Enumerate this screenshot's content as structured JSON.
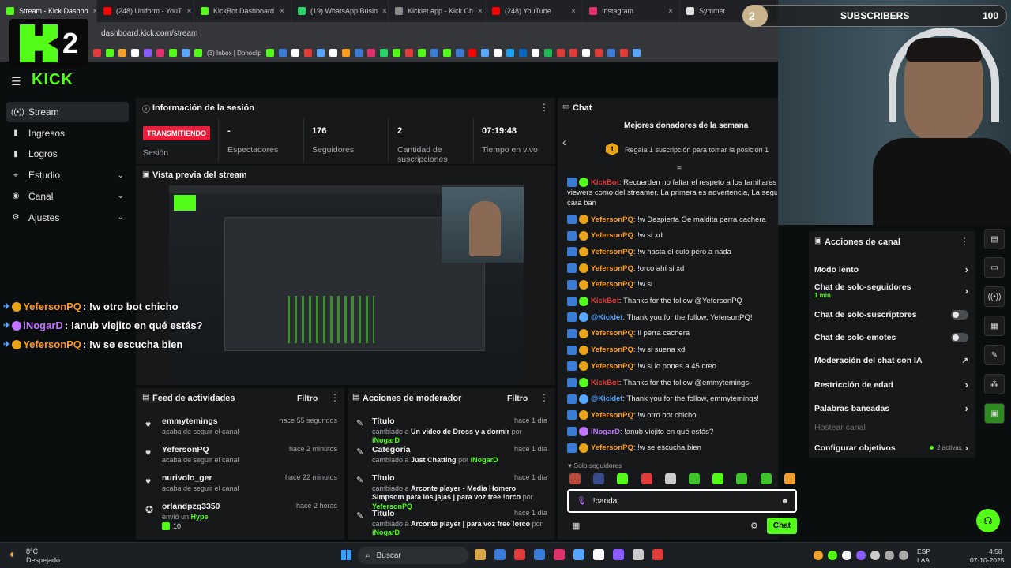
{
  "browser": {
    "tabs": [
      {
        "label": "Stream - Kick Dashbo",
        "active": true,
        "color": "#53fc18"
      },
      {
        "label": "(248) Uniform - YouT",
        "color": "#ff0000"
      },
      {
        "label": "KickBot Dashboard",
        "color": "#53fc18"
      },
      {
        "label": "(19) WhatsApp Busin",
        "color": "#25d366"
      },
      {
        "label": "Kicklet.app - Kick Ch",
        "color": "#888888"
      },
      {
        "label": "(248) YouTube",
        "color": "#ff0000"
      },
      {
        "label": "Instagram",
        "color": "#e1306c"
      },
      {
        "label": "Symmet",
        "color": "#dddddd"
      }
    ],
    "url": "dashboard.kick.com/stream",
    "bookmark_text": "(3) Inbox | Donoclip"
  },
  "kick_logo_text": "2",
  "brand": "KICK",
  "sidebar": {
    "items": [
      {
        "label": "Stream",
        "icon": "stream-icon",
        "glyph": "((•))",
        "active": true,
        "chevron": false
      },
      {
        "label": "Ingresos",
        "icon": "money-icon",
        "glyph": "▮",
        "chevron": false
      },
      {
        "label": "Logros",
        "icon": "trophy-icon",
        "glyph": "▮",
        "chevron": false
      },
      {
        "label": "Estudio",
        "icon": "studio-icon",
        "glyph": "⌖",
        "chevron": true
      },
      {
        "label": "Canal",
        "icon": "channel-icon",
        "glyph": "◉",
        "chevron": true
      },
      {
        "label": "Ajustes",
        "icon": "settings-icon",
        "glyph": "⚙",
        "chevron": true
      }
    ]
  },
  "session": {
    "title": "Información de la sesión",
    "live_badge": "TRANSMITIENDO",
    "session_label": "Sesión",
    "stats": [
      {
        "value": "-",
        "label": "Espectadores"
      },
      {
        "value": "176",
        "label": "Seguidores"
      },
      {
        "value": "2",
        "label": "Cantidad de suscripciones"
      },
      {
        "value": "07:19:48",
        "label": "Tiempo en vivo"
      }
    ]
  },
  "preview": {
    "title": "Vista previa del stream"
  },
  "activity": {
    "title": "Feed de actividades",
    "filter": "Filtro",
    "items": [
      {
        "name": "emmytemings",
        "sub": "acaba de seguir el canal",
        "time": "hace 55 segundos",
        "icon": "heart-icon"
      },
      {
        "name": "YefersonPQ",
        "sub": "acaba de seguir el canal",
        "time": "hace 2 minutos",
        "icon": "heart-icon"
      },
      {
        "name": "nurivolo_ger",
        "sub": "acaba de seguir el canal",
        "time": "hace 22 minutos",
        "icon": "heart-icon"
      },
      {
        "name": "orlandpzg3350",
        "sub_prefix": "envió un",
        "sub_highlight": "Hype",
        "extra": "10",
        "time": "hace 2 horas",
        "icon": "kick-icon"
      }
    ]
  },
  "mod": {
    "title": "Acciones de moderador",
    "filter": "Filtro",
    "items": [
      {
        "title": "Título",
        "pre": "cambiado a",
        "value": "Un video de Dross y a dormir",
        "by_pre": "por",
        "by": "iNogarD",
        "time": "hace 1 día"
      },
      {
        "title": "Categoría",
        "pre": "cambiado a",
        "value": "Just Chatting",
        "by_pre": "por",
        "by": "iNogarD",
        "time": "hace 1 día"
      },
      {
        "title": "Título",
        "pre": "cambiado a",
        "value": "Arconte player - Media Homero Simpsom para los jajas | para voz free !orco",
        "by_pre": "por",
        "by": "YefersonPQ",
        "time": "hace 1 día"
      },
      {
        "title": "Título",
        "pre": "cambiado a",
        "value": "Arconte player | para voz free !orco",
        "by_pre": "por",
        "by": "iNogarD",
        "time": "hace 1 día"
      }
    ]
  },
  "chat": {
    "title": "Chat",
    "donors_title": "Mejores donadores de la semana",
    "donors_rank": "1",
    "donors_text": "Regala 1 suscripción para tomar la posición 1",
    "messages": [
      {
        "user": "KickBot",
        "color": "#e23b3b",
        "text": ": Recuerden no faltar el respeto a los familiares de",
        "badge": "bot"
      },
      {
        "user": "",
        "color": "#e8e8e8",
        "text": "viewers como del streamer. La primera es advertencia, La segunda",
        "badge": "none"
      },
      {
        "user": "",
        "color": "#e8e8e8",
        "text": "cara ban",
        "badge": "none"
      },
      {
        "user": "YefersonPQ",
        "color": "#ff9c1a",
        "text": ": !w Despierta Oe maldita perra cachera",
        "badge": "sub"
      },
      {
        "user": "YefersonPQ",
        "color": "#ff9c1a",
        "text": ": !w si xd",
        "badge": "sub"
      },
      {
        "user": "YefersonPQ",
        "color": "#ff9c1a",
        "text": ": !w hasta el culo pero a nada",
        "badge": "sub"
      },
      {
        "user": "YefersonPQ",
        "color": "#ff9c1a",
        "text": ": !orco ahí si xd",
        "badge": "sub"
      },
      {
        "user": "YefersonPQ",
        "color": "#ff9c1a",
        "text": ": !w si",
        "badge": "sub"
      },
      {
        "user": "KickBot",
        "color": "#e23b3b",
        "text": ": Thanks for the follow @YefersonPQ",
        "badge": "bot"
      },
      {
        "user": "@Kicklet",
        "color": "#58a6ff",
        "text": ": Thank you for the follow, YefersonPQ!",
        "badge": "robot"
      },
      {
        "user": "YefersonPQ",
        "color": "#ff9c1a",
        "text": ": !l perra cachera",
        "badge": "sub"
      },
      {
        "user": "YefersonPQ",
        "color": "#ff9c1a",
        "text": ": !w si suena xd",
        "badge": "sub"
      },
      {
        "user": "YefersonPQ",
        "color": "#ff9c1a",
        "text": ": !w si lo pones a 45 creo",
        "badge": "sub"
      },
      {
        "user": "KickBot",
        "color": "#e23b3b",
        "text": ": Thanks for the follow @emmytemings",
        "badge": "bot"
      },
      {
        "user": "@Kicklet",
        "color": "#58a6ff",
        "text": ": Thank you for the follow, emmytemings!",
        "badge": "robot"
      },
      {
        "user": "YefersonPQ",
        "color": "#ff9c1a",
        "text": ": !w otro bot chicho",
        "badge": "sub"
      },
      {
        "user": "iNogarD",
        "color": "#c074ff",
        "text": ": !anub viejito en qué estás?",
        "badge": "mic"
      },
      {
        "user": "YefersonPQ",
        "color": "#ff9c1a",
        "text": ": !w se escucha bien",
        "badge": "sub"
      }
    ],
    "followers_only": "Solo seguidores",
    "input_value": "!panda",
    "send_label": "Chat"
  },
  "overlay": {
    "subs_count": "2",
    "subs_label": "SUBSCRIBERS",
    "subs_goal": "100",
    "chat": [
      {
        "user": "YefersonPQ",
        "text": ": !w otro bot chicho",
        "color": "#ff9c1a"
      },
      {
        "user": "iNogarD",
        "text": ": !anub viejito en qué estás?",
        "color": "#c074ff"
      },
      {
        "user": "YefersonPQ",
        "text": ": !w se escucha bien",
        "color": "#ff9c1a"
      }
    ]
  },
  "channel_actions": {
    "title": "Acciones de canal",
    "items": [
      {
        "label": "Modo lento",
        "kind": "chevron"
      },
      {
        "label": "Chat de solo-seguidores",
        "sub": "1 min",
        "kind": "chevron"
      },
      {
        "label": "Chat de solo-suscriptores",
        "kind": "toggle"
      },
      {
        "label": "Chat de solo-emotes",
        "kind": "toggle"
      },
      {
        "label": "Moderación del chat con IA",
        "kind": "external"
      },
      {
        "label": "Restricción de edad",
        "kind": "chevron"
      },
      {
        "label": "Palabras baneadas",
        "kind": "chevron"
      },
      {
        "label": "Hostear canal",
        "kind": "disabled"
      },
      {
        "label": "Configurar objetivos",
        "kind": "chevron",
        "badge": "2 activas"
      }
    ]
  },
  "taskbar": {
    "weather_temp": "8°C",
    "weather_desc": "Despejado",
    "search": "Buscar",
    "lang": "ESP",
    "lang2": "LAA",
    "time": "4:58",
    "date": "07-10-2025"
  },
  "colors": {
    "accent": "#53fc18",
    "live": "#e91e3c"
  }
}
